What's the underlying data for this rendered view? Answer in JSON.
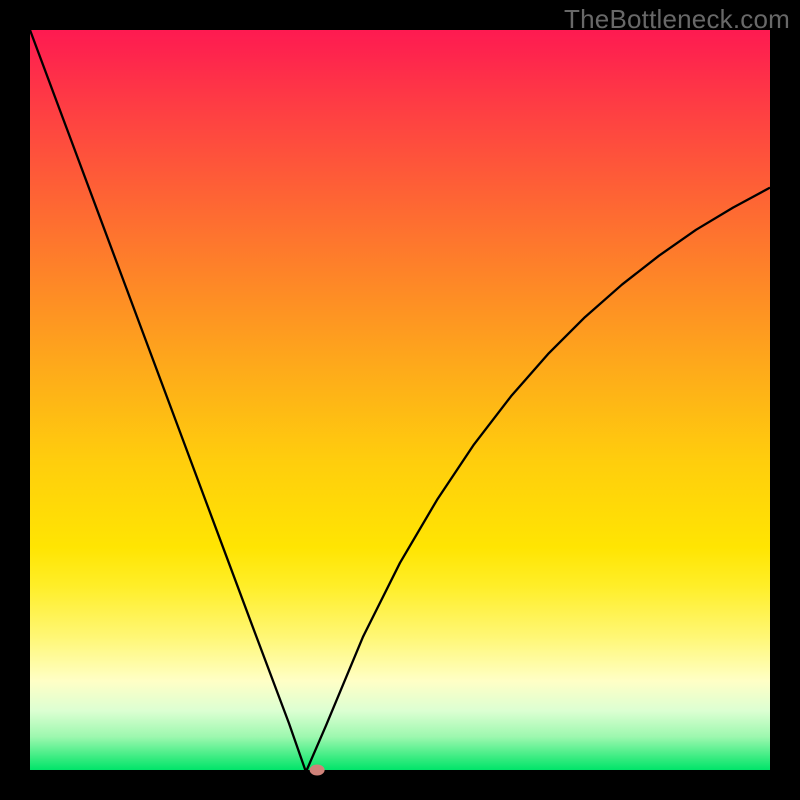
{
  "watermark": "TheBottleneck.com",
  "chart_data": {
    "type": "line",
    "title": "",
    "xlabel": "",
    "ylabel": "",
    "x": [
      0.0,
      0.05,
      0.1,
      0.15,
      0.2,
      0.25,
      0.3,
      0.35,
      0.372,
      0.374,
      0.4,
      0.45,
      0.5,
      0.55,
      0.6,
      0.65,
      0.7,
      0.75,
      0.8,
      0.85,
      0.9,
      0.95,
      1.0
    ],
    "values": [
      100,
      86.6,
      73.2,
      59.8,
      46.4,
      33.0,
      19.6,
      6.3,
      0.0,
      0.0,
      6.0,
      18.0,
      28.0,
      36.5,
      44.0,
      50.5,
      56.2,
      61.2,
      65.6,
      69.5,
      73.0,
      76.0,
      78.7
    ],
    "xlim": [
      0,
      1
    ],
    "ylim": [
      0,
      100
    ],
    "marker": {
      "x": 0.388,
      "y": 0.0
    },
    "colors": {
      "top": "#fe1a51",
      "mid": "#ffe601",
      "bottom": "#01e46a"
    }
  }
}
